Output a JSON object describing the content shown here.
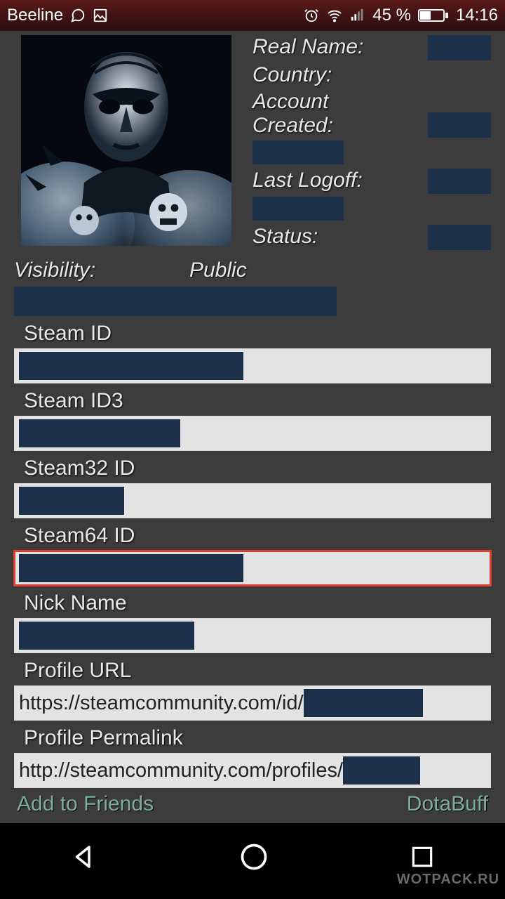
{
  "status": {
    "carrier": "Beeline",
    "battery_pct": "45 %",
    "time": "14:16"
  },
  "profile": {
    "labels": {
      "real_name": "Real Name:",
      "country": "Country:",
      "account_created": "Account Created:",
      "last_logoff": "Last Logoff:",
      "status": "Status:",
      "visibility": "Visibility:"
    },
    "visibility_value": "Public"
  },
  "fields": [
    {
      "label": "Steam ID",
      "redact_width": 320,
      "highlight": false,
      "url_prefix": ""
    },
    {
      "label": "Steam ID3",
      "redact_width": 230,
      "highlight": false,
      "url_prefix": ""
    },
    {
      "label": "Steam32 ID",
      "redact_width": 150,
      "highlight": false,
      "url_prefix": ""
    },
    {
      "label": "Steam64 ID",
      "redact_width": 320,
      "highlight": true,
      "url_prefix": ""
    },
    {
      "label": "Nick Name",
      "redact_width": 250,
      "highlight": false,
      "url_prefix": ""
    },
    {
      "label": "Profile URL",
      "redact_width": 170,
      "highlight": false,
      "url_prefix": "https://steamcommunity.com/id/"
    },
    {
      "label": "Profile Permalink",
      "redact_width": 110,
      "highlight": false,
      "url_prefix": "http://steamcommunity.com/profiles/"
    }
  ],
  "links": {
    "add_friends": "Add to Friends",
    "dotabuff": "DotaBuff"
  },
  "watermark": "WOTPACK.RU"
}
